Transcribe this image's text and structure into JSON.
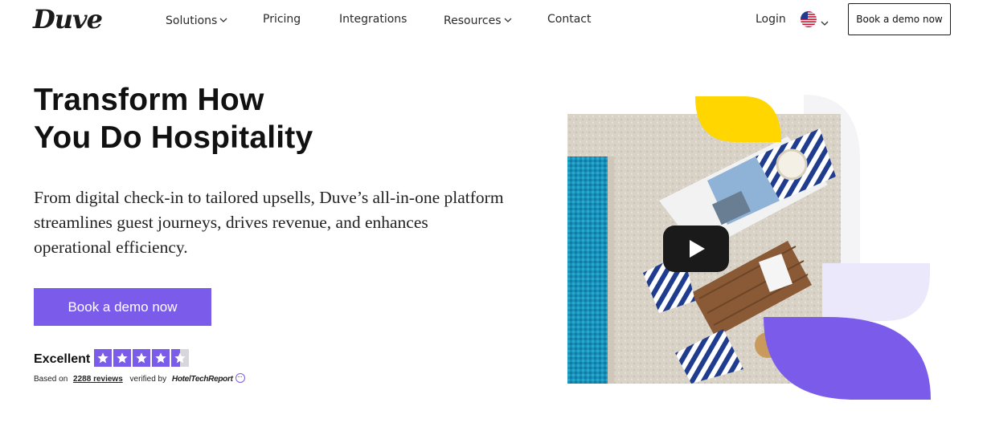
{
  "nav": {
    "logo": "Duve",
    "items": [
      {
        "label": "Solutions",
        "has_dropdown": true
      },
      {
        "label": "Pricing",
        "has_dropdown": false
      },
      {
        "label": "Integrations",
        "has_dropdown": false
      },
      {
        "label": "Resources",
        "has_dropdown": true
      },
      {
        "label": "Contact",
        "has_dropdown": false
      }
    ],
    "login_label": "Login",
    "language_flag": "us-flag-icon",
    "cta_label": "Book a demo now"
  },
  "hero": {
    "title_line1": "Transform How",
    "title_line2": "You Do Hospitality",
    "subtitle": "From digital check-in to tailored upsells, Duve’s all-in-one platform streamlines guest journeys, drives revenue, and enhances operational efficiency.",
    "cta_label": "Book a demo now"
  },
  "rating": {
    "label": "Excellent",
    "stars": 4.5,
    "based_on_prefix": "Based on",
    "reviews_link": "2288 reviews",
    "verified_by": "verified by",
    "verifier": "HotelTechReport"
  },
  "colors": {
    "brand_purple": "#7b5cea",
    "light_purple": "#ece8fb",
    "yellow": "#ffd600",
    "text_dark": "#111111"
  }
}
